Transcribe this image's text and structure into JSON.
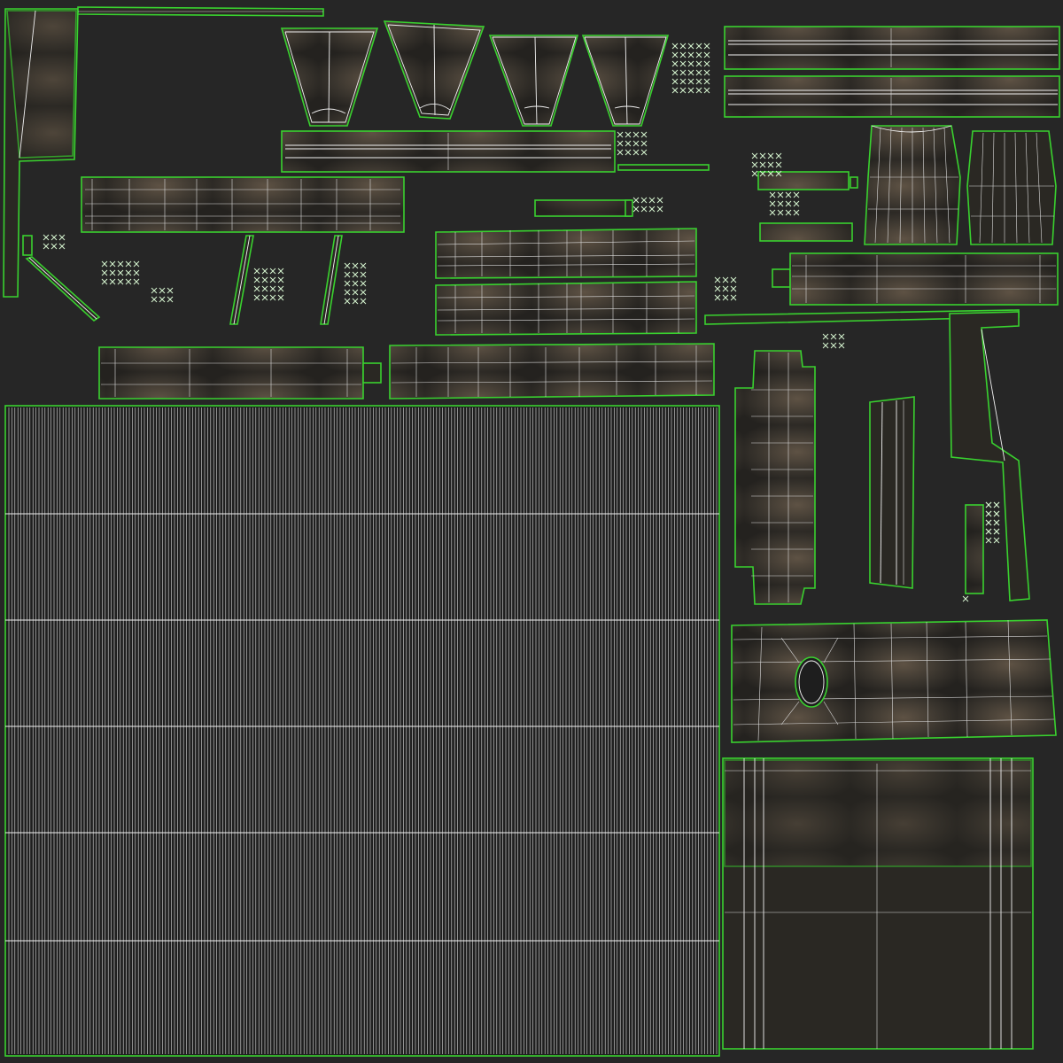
{
  "texture": {
    "colors": {
      "background": "#262626",
      "shell_outline": "#39d12f",
      "wireframe": "#f2f2f2",
      "surface_dark": "#2a2823",
      "surface_light": "#5e5244"
    }
  }
}
